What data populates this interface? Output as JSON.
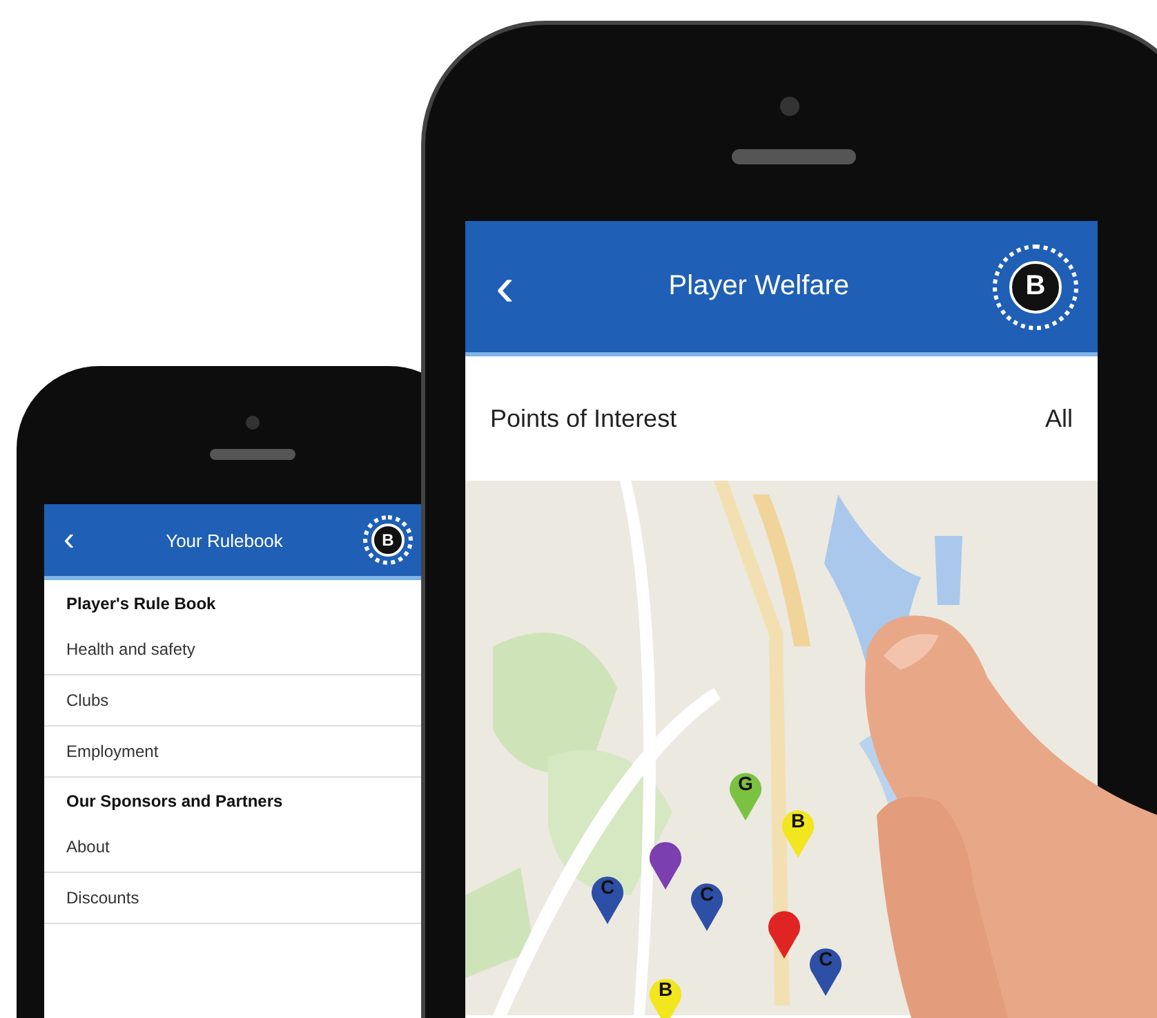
{
  "back_phone": {
    "header": {
      "back": "‹",
      "title": "Your Rulebook",
      "logo": "B"
    },
    "items": [
      {
        "label": "Player's Rule Book",
        "kind": "section"
      },
      {
        "label": "Health and safety",
        "kind": "link"
      },
      {
        "label": "Clubs",
        "kind": "link"
      },
      {
        "label": "Employment",
        "kind": "link"
      },
      {
        "label": "Our Sponsors and Partners",
        "kind": "section"
      },
      {
        "label": "About",
        "kind": "link"
      },
      {
        "label": "Discounts",
        "kind": "link"
      }
    ]
  },
  "front_phone": {
    "header": {
      "back": "‹",
      "title": "Player Welfare",
      "logo": "B"
    },
    "filter": {
      "label": "Points of Interest",
      "value": "All"
    },
    "map": {
      "kind": "picture",
      "pins": [
        {
          "letter": "G",
          "color": "#7cc242"
        },
        {
          "letter": "B",
          "color": "#f2e61e"
        },
        {
          "color": "#7b3fb0"
        },
        {
          "letter": "C",
          "color": "#2e4fa6"
        },
        {
          "letter": "C",
          "color": "#2e4fa6"
        },
        {
          "color": "#e02424"
        },
        {
          "letter": "C",
          "color": "#2e4fa6"
        },
        {
          "letter": "B",
          "color": "#f2e61e"
        }
      ]
    }
  }
}
